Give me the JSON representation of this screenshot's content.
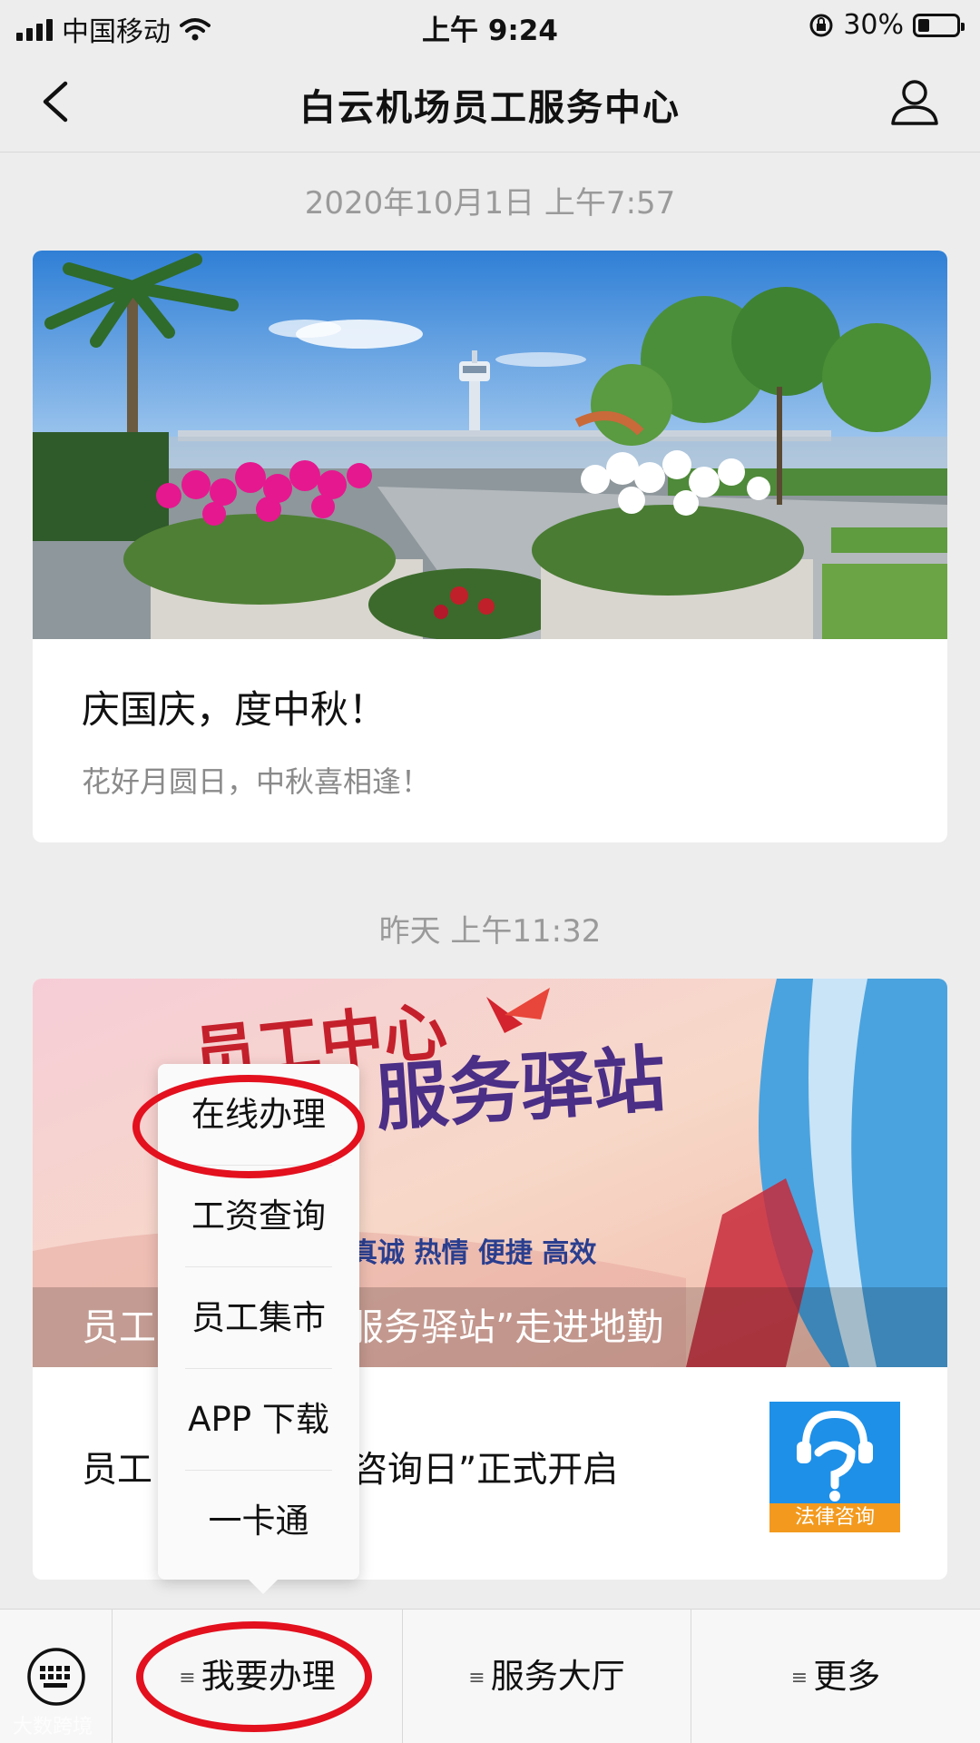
{
  "status_bar": {
    "carrier": "中国移动",
    "time": "上午 9:24",
    "battery": "30%",
    "battery_level": 0.3
  },
  "nav": {
    "title": "白云机场员工服务中心",
    "back_icon": "chevron-left-icon",
    "profile_icon": "user-icon"
  },
  "messages": [
    {
      "timestamp": "2020年10月1日 上午7:57",
      "title": "庆国庆，度中秋！",
      "subtitle": "花好月圆日，中秋喜相逢！"
    },
    {
      "timestamp": "昨天 上午11:32",
      "banner_title_left": "员工",
      "banner_title_right": "服务驿站”走进地勤",
      "banner_art_line1": "员工中心",
      "banner_art_line2": "服务驿站",
      "banner_slogan": "真诚  热情  便捷  高效",
      "item_title_left": "员工",
      "item_title_right": "咨询日”正式开启",
      "thumb_label": "法律咨询"
    }
  ],
  "popup_menu": {
    "items": [
      "在线办理",
      "工资查询",
      "员工集市",
      "APP 下载",
      "一卡通"
    ]
  },
  "bottom_menu": {
    "keyboard_icon": "keyboard-icon",
    "tabs": [
      "我要办理",
      "服务大厅",
      "更多"
    ]
  },
  "watermark": "大数跨境",
  "colors": {
    "highlight": "#e3101e",
    "background": "#ededed",
    "thumb_blue": "#1e90e8",
    "thumb_orange": "#f39a1e"
  }
}
